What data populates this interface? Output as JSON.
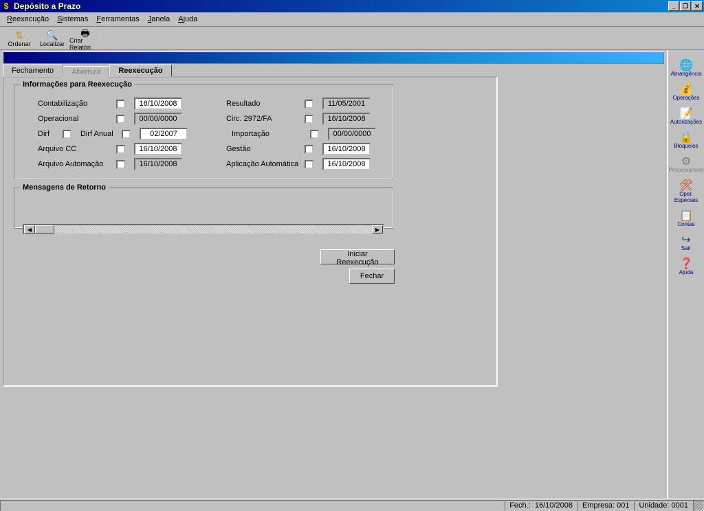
{
  "titlebar": {
    "title": "Depósito a Prazo"
  },
  "menubar": {
    "reexecucao": "Reexecução",
    "sistemas": "Sistemas",
    "ferramentas": "Ferramentas",
    "janela": "Janela",
    "ajuda": "Ajuda"
  },
  "toolbar": {
    "ordenar": "Ordenar",
    "localizar": "Localizar",
    "criar_relatorio": "Criar Relatóri"
  },
  "tabs": {
    "fechamento": "Fechamento",
    "abertura": "Abertura",
    "reexecucao": "Reexecução"
  },
  "group": {
    "info_title": "Informações para Reexecução",
    "messages_title": "Mensagens de Retorno",
    "labels": {
      "contabilizacao": "Contabilização",
      "operacional": "Operacional",
      "dirf": "Dirf",
      "dirf_anual": "Dirf Anual",
      "arquivo_cc": "Arquivo CC",
      "arquivo_automacao": "Arquivo Automação",
      "resultado": "Resultado",
      "circ": "Circ. 2972/FA",
      "importacao": "Importação",
      "gestao": "Gestão",
      "aplicacao_auto": "Aplicação Automática"
    },
    "values": {
      "contabilizacao": "16/10/2008",
      "operacional": "00/00/0000",
      "dirf_anual": "02/2007",
      "arquivo_cc": "16/10/2008",
      "arquivo_automacao": "16/10/2008",
      "resultado": "11/05/2001",
      "circ": "16/10/2008",
      "importacao": "00/00/0000",
      "gestao": "16/10/2008",
      "aplicacao_auto": "16/10/2008"
    }
  },
  "buttons": {
    "iniciar": "Iniciar Reexecução",
    "fechar": "Fechar"
  },
  "sidebar": {
    "abrangencia": "Abrangência",
    "operacoes": "Operações",
    "autorizacoes": "Autorizações",
    "bloqueios": "Bloqueios",
    "processamento": "Processament",
    "oper_especiais": "Oper. Especiais",
    "contas": "Contas",
    "sair": "Sair",
    "ajuda": "Ajuda"
  },
  "statusbar": {
    "fech_label": "Fech.:",
    "fech_value": "16/10/2008",
    "empresa": "Empresa: 001",
    "unidade": "Unidade: 0001"
  }
}
